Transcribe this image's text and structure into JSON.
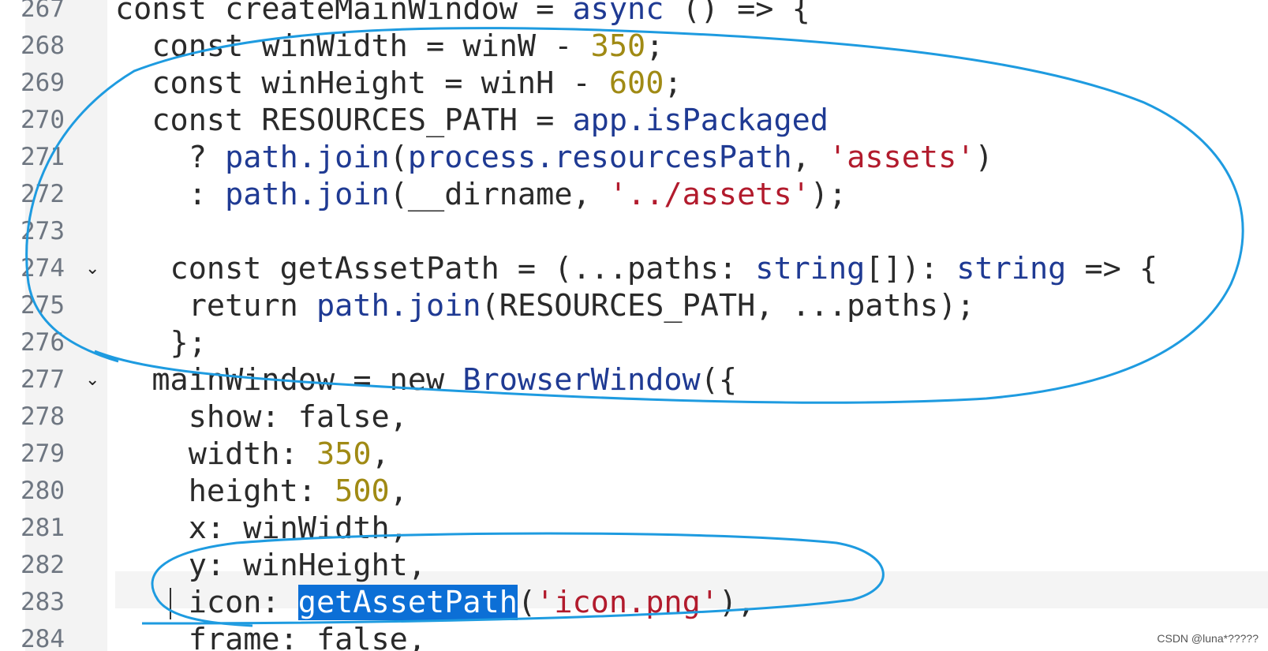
{
  "editor": {
    "lines": [
      {
        "number": "267",
        "fold": "",
        "tokens": [
          {
            "text": "const createMainWindow = ",
            "cls": "plain"
          },
          {
            "text": "async",
            "cls": "kw"
          },
          {
            "text": " () => {",
            "cls": "plain"
          }
        ]
      },
      {
        "number": "268",
        "fold": "",
        "tokens": [
          {
            "text": "  const winWidth = winW - ",
            "cls": "plain"
          },
          {
            "text": "350",
            "cls": "num"
          },
          {
            "text": ";",
            "cls": "plain"
          }
        ]
      },
      {
        "number": "269",
        "fold": "",
        "tokens": [
          {
            "text": "  const winHeight = winH - ",
            "cls": "plain"
          },
          {
            "text": "600",
            "cls": "num"
          },
          {
            "text": ";",
            "cls": "plain"
          }
        ]
      },
      {
        "number": "270",
        "fold": "",
        "tokens": [
          {
            "text": "  const RESOURCES_PATH = ",
            "cls": "plain"
          },
          {
            "text": "app.isPackaged",
            "cls": "ident"
          }
        ]
      },
      {
        "number": "271",
        "fold": "",
        "tokens": [
          {
            "text": "    ? ",
            "cls": "plain"
          },
          {
            "text": "path.join",
            "cls": "ident"
          },
          {
            "text": "(",
            "cls": "plain"
          },
          {
            "text": "process.resourcesPath",
            "cls": "ident"
          },
          {
            "text": ", ",
            "cls": "plain"
          },
          {
            "text": "'assets'",
            "cls": "str"
          },
          {
            "text": ")",
            "cls": "plain"
          }
        ]
      },
      {
        "number": "272",
        "fold": "",
        "tokens": [
          {
            "text": "    : ",
            "cls": "plain"
          },
          {
            "text": "path.join",
            "cls": "ident"
          },
          {
            "text": "(__dirname, ",
            "cls": "plain"
          },
          {
            "text": "'../assets'",
            "cls": "str"
          },
          {
            "text": ");",
            "cls": "plain"
          }
        ]
      },
      {
        "number": "273",
        "fold": "",
        "tokens": []
      },
      {
        "number": "274",
        "fold": "⌄",
        "tokens": [
          {
            "text": "   const getAssetPath = (...paths: ",
            "cls": "plain"
          },
          {
            "text": "string",
            "cls": "kw"
          },
          {
            "text": "[]): ",
            "cls": "plain"
          },
          {
            "text": "string",
            "cls": "kw"
          },
          {
            "text": " => {",
            "cls": "plain"
          }
        ]
      },
      {
        "number": "275",
        "fold": "",
        "tokens": [
          {
            "text": "    return ",
            "cls": "plain"
          },
          {
            "text": "path.join",
            "cls": "ident"
          },
          {
            "text": "(RESOURCES_PATH, ...paths);",
            "cls": "plain"
          }
        ]
      },
      {
        "number": "276",
        "fold": "",
        "tokens": [
          {
            "text": "   };",
            "cls": "plain"
          }
        ]
      },
      {
        "number": "277",
        "fold": "⌄",
        "tokens": [
          {
            "text": "  mainWindow = new ",
            "cls": "plain"
          },
          {
            "text": "BrowserWindow",
            "cls": "kw"
          },
          {
            "text": "({",
            "cls": "plain"
          }
        ]
      },
      {
        "number": "278",
        "fold": "",
        "tokens": [
          {
            "text": "    show: false,",
            "cls": "plain"
          }
        ]
      },
      {
        "number": "279",
        "fold": "",
        "tokens": [
          {
            "text": "    width: ",
            "cls": "plain"
          },
          {
            "text": "350",
            "cls": "num"
          },
          {
            "text": ",",
            "cls": "plain"
          }
        ]
      },
      {
        "number": "280",
        "fold": "",
        "tokens": [
          {
            "text": "    height: ",
            "cls": "plain"
          },
          {
            "text": "500",
            "cls": "num"
          },
          {
            "text": ",",
            "cls": "plain"
          }
        ]
      },
      {
        "number": "281",
        "fold": "",
        "tokens": [
          {
            "text": "    x: winWidth,",
            "cls": "plain"
          }
        ]
      },
      {
        "number": "282",
        "fold": "",
        "tokens": [
          {
            "text": "    y: winHeight,",
            "cls": "plain"
          }
        ]
      },
      {
        "number": "283",
        "fold": "",
        "tokens": [
          {
            "text": "    icon: ",
            "cls": "plain"
          },
          {
            "text": "getAssetPath",
            "cls": "sel"
          },
          {
            "text": "(",
            "cls": "plain"
          },
          {
            "text": "'icon.png'",
            "cls": "str"
          },
          {
            "text": "),",
            "cls": "plain"
          }
        ]
      },
      {
        "number": "284",
        "fold": "",
        "tokens": [
          {
            "text": "    frame: false,",
            "cls": "plain"
          }
        ]
      }
    ]
  },
  "watermark": "CSDN @luna*?????",
  "colors": {
    "annotation": "#1e9be0",
    "selection": "#0c6fd6",
    "string": "#b21b2d",
    "number": "#a08a14",
    "identifier": "#1f3a93"
  }
}
